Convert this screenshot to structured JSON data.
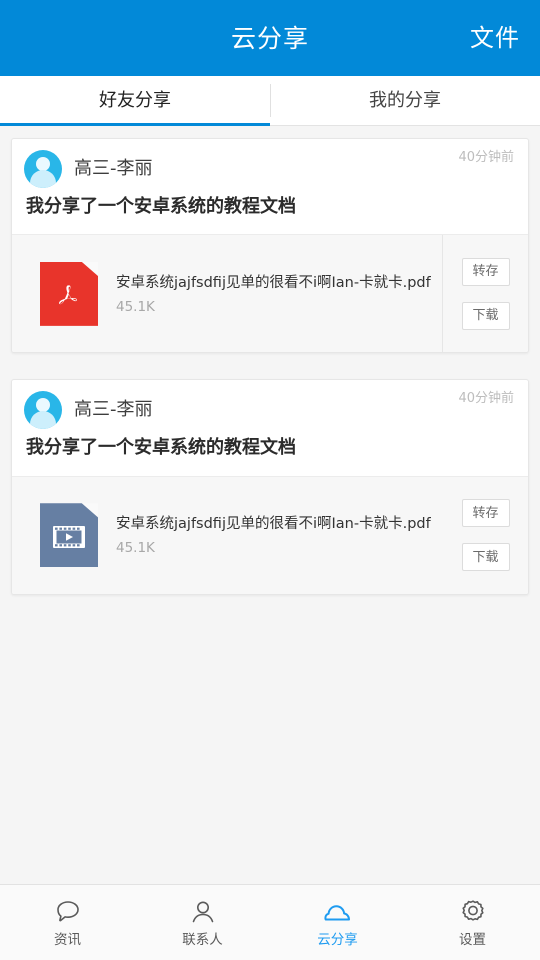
{
  "header": {
    "title": "云分享",
    "action_label": "文件",
    "background_color": "#0289d8",
    "text_color": "#ffffff"
  },
  "tabs": [
    {
      "label": "好友分享",
      "active": true
    },
    {
      "label": "我的分享",
      "active": false
    }
  ],
  "feed": {
    "cards": [
      {
        "poster_name": "高三-李丽",
        "timestamp": "40分钟前",
        "message": "我分享了一个安卓系统的教程文档",
        "file": {
          "name": "安卓系统jajfsdfij见单的很看不i啊Ian-卡就卡.pdf",
          "size": "45.1K",
          "icon": "pdf-file-icon",
          "icon_color": "#e8342b"
        },
        "actions": [
          {
            "label": "转存",
            "name": "save-to-cloud-button"
          },
          {
            "label": "下载",
            "name": "download-button"
          }
        ]
      },
      {
        "poster_name": "高三-李丽",
        "timestamp": "40分钟前",
        "message": "我分享了一个安卓系统的教程文档",
        "file": {
          "name": "安卓系统jajfsdfij见单的很看不i啊Ian-卡就卡.pdf",
          "size": "45.1K",
          "icon": "video-file-icon",
          "icon_color": "#667fa3"
        },
        "actions": [
          {
            "label": "转存",
            "name": "save-to-cloud-button"
          },
          {
            "label": "下载",
            "name": "download-button"
          }
        ]
      }
    ]
  },
  "bottom_nav": {
    "active_color": "#1e9bf0",
    "items": [
      {
        "label": "资讯",
        "icon": "chat-bubble-icon",
        "active": false
      },
      {
        "label": "联系人",
        "icon": "person-icon",
        "active": false
      },
      {
        "label": "云分享",
        "icon": "cloud-icon",
        "active": true
      },
      {
        "label": "设置",
        "icon": "gear-icon",
        "active": false
      }
    ]
  }
}
